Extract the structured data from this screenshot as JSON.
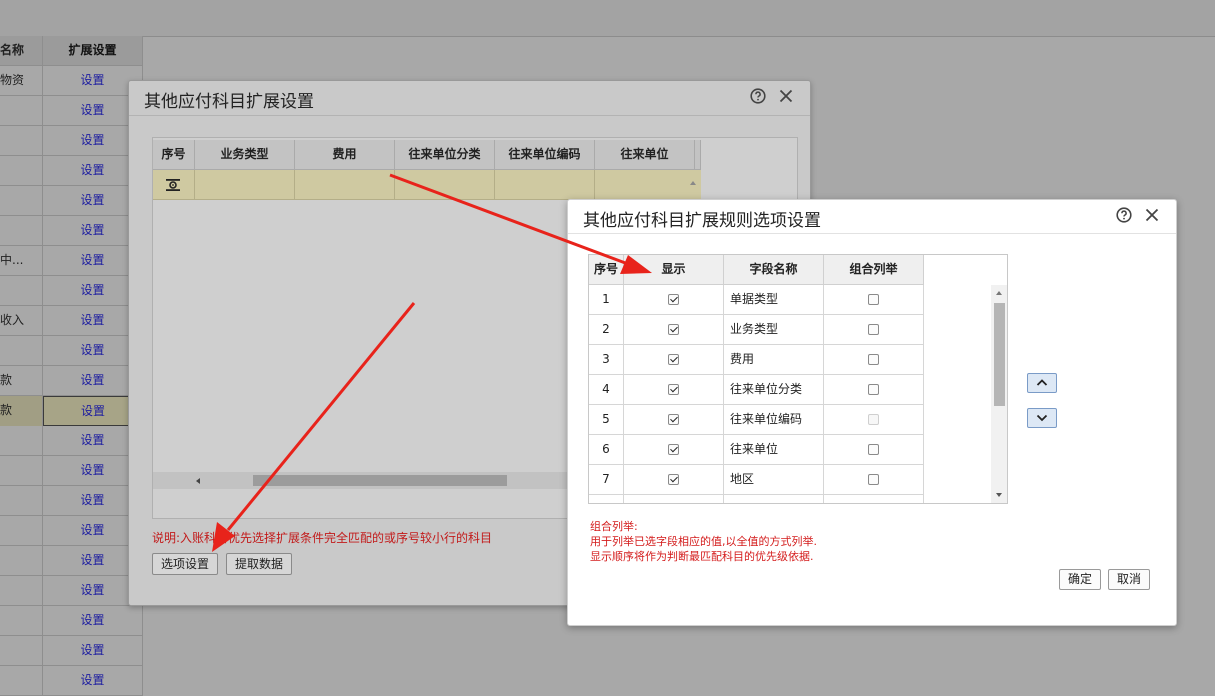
{
  "bg_table": {
    "header": {
      "col1": "名称",
      "col2": "扩展设置"
    },
    "rows": [
      {
        "c1": "物资",
        "c2": "设置"
      },
      {
        "c1": "",
        "c2": "设置"
      },
      {
        "c1": "",
        "c2": "设置"
      },
      {
        "c1": "",
        "c2": "设置"
      },
      {
        "c1": "",
        "c2": "设置"
      },
      {
        "c1": "",
        "c2": "设置"
      },
      {
        "c1": "中...",
        "c2": "设置"
      },
      {
        "c1": "",
        "c2": "设置"
      },
      {
        "c1": "收入",
        "c2": "设置"
      },
      {
        "c1": "",
        "c2": "设置"
      },
      {
        "c1": "款",
        "c2": "设置"
      },
      {
        "c1": "款",
        "c2": "设置"
      },
      {
        "c1": "",
        "c2": "设置"
      },
      {
        "c1": "",
        "c2": "设置"
      },
      {
        "c1": "",
        "c2": "设置"
      },
      {
        "c1": "",
        "c2": "设置"
      },
      {
        "c1": "",
        "c2": "设置"
      },
      {
        "c1": "",
        "c2": "设置"
      },
      {
        "c1": "",
        "c2": "设置"
      },
      {
        "c1": "",
        "c2": "设置"
      },
      {
        "c1": "",
        "c2": "设置"
      }
    ]
  },
  "dialog1": {
    "title": "其他应付科目扩展设置",
    "columns": [
      "序号",
      "业务类型",
      "费用",
      "往来单位分类",
      "往来单位编码",
      "往来单位"
    ],
    "note": "说明:入账科目优先选择扩展条件完全匹配的或序号较小行的科目",
    "buttons": {
      "options": "选项设置",
      "fetch": "提取数据"
    }
  },
  "dialog2": {
    "title": "其他应付科目扩展规则选项设置",
    "columns": [
      "序号",
      "显示",
      "字段名称",
      "组合列举"
    ],
    "rows": [
      {
        "no": "1",
        "show": true,
        "field": "单据类型",
        "combo": false,
        "combo_disabled": false
      },
      {
        "no": "2",
        "show": true,
        "field": "业务类型",
        "combo": false,
        "combo_disabled": false
      },
      {
        "no": "3",
        "show": true,
        "field": "费用",
        "combo": false,
        "combo_disabled": false
      },
      {
        "no": "4",
        "show": true,
        "field": "往来单位分类",
        "combo": false,
        "combo_disabled": false
      },
      {
        "no": "5",
        "show": true,
        "field": "往来单位编码",
        "combo": false,
        "combo_disabled": true
      },
      {
        "no": "6",
        "show": true,
        "field": "往来单位",
        "combo": false,
        "combo_disabled": false
      },
      {
        "no": "7",
        "show": true,
        "field": "地区",
        "combo": false,
        "combo_disabled": false
      }
    ],
    "notes": [
      "组合列举:",
      "用于列举已选字段相应的值,以全值的方式列举.",
      "显示顺序将作为判断最匹配科目的优先级依据."
    ],
    "buttons": {
      "ok": "确定",
      "cancel": "取消"
    }
  },
  "colors": {
    "arrow": "#e8231b",
    "note": "#d41c1c",
    "link": "#1c1ca0"
  }
}
